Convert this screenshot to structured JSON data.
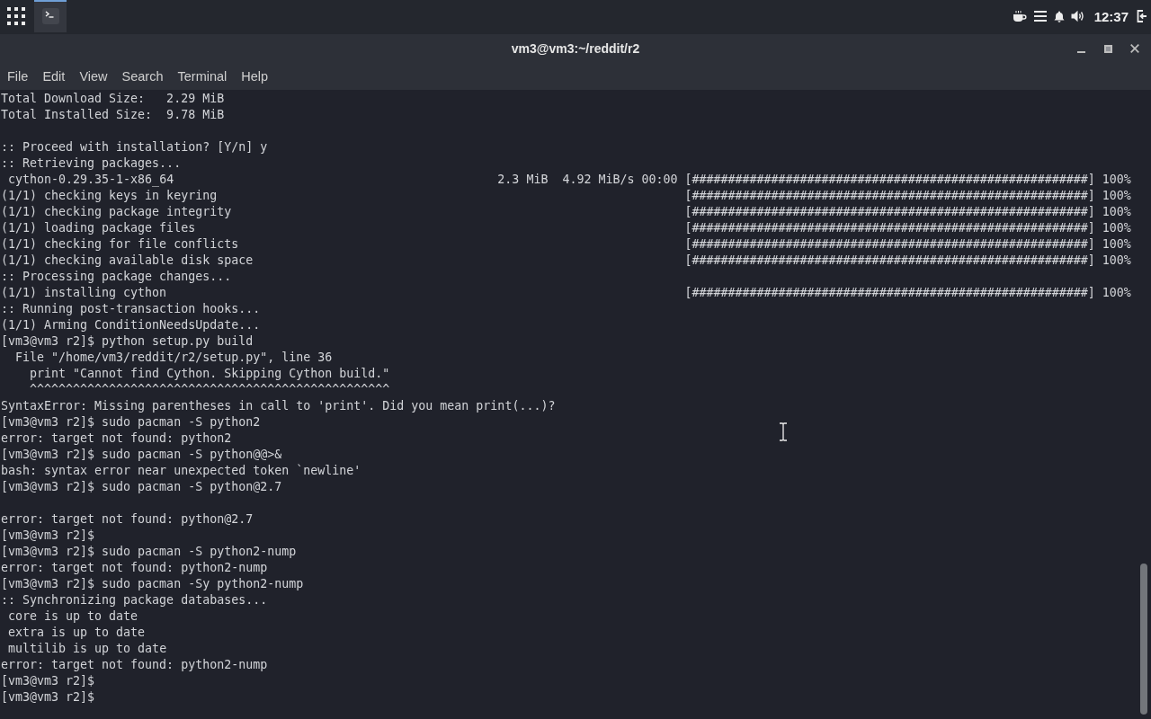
{
  "top_panel": {
    "taskbar": [
      {
        "selected": true
      }
    ],
    "clock": "12:37"
  },
  "window": {
    "title": "vm3@vm3:~/reddit/r2"
  },
  "menu": [
    "File",
    "Edit",
    "View",
    "Search",
    "Terminal",
    "Help"
  ],
  "terminal": {
    "lines": [
      {
        "kind": "text",
        "text": "Total Download Size:   2.29 MiB"
      },
      {
        "kind": "text",
        "text": "Total Installed Size:  9.78 MiB"
      },
      {
        "kind": "blank"
      },
      {
        "kind": "text",
        "text": ":: Proceed with installation? [Y/n] y"
      },
      {
        "kind": "text",
        "text": ":: Retrieving packages..."
      },
      {
        "kind": "progress",
        "text": " cython-0.29.35-1-x86_64",
        "stats": "2.3 MiB  4.92 MiB/s 00:00",
        "progress": "[#######################################################] 100%"
      },
      {
        "kind": "progress",
        "text": "(1/1) checking keys in keyring",
        "progress": "[#######################################################] 100%"
      },
      {
        "kind": "progress",
        "text": "(1/1) checking package integrity",
        "progress": "[#######################################################] 100%"
      },
      {
        "kind": "progress",
        "text": "(1/1) loading package files",
        "progress": "[#######################################################] 100%"
      },
      {
        "kind": "progress",
        "text": "(1/1) checking for file conflicts",
        "progress": "[#######################################################] 100%"
      },
      {
        "kind": "progress",
        "text": "(1/1) checking available disk space",
        "progress": "[#######################################################] 100%"
      },
      {
        "kind": "text",
        "text": ":: Processing package changes..."
      },
      {
        "kind": "progress",
        "text": "(1/1) installing cython",
        "progress": "[#######################################################] 100%"
      },
      {
        "kind": "text",
        "text": ":: Running post-transaction hooks..."
      },
      {
        "kind": "text",
        "text": "(1/1) Arming ConditionNeedsUpdate..."
      },
      {
        "kind": "text",
        "text": "[vm3@vm3 r2]$ python setup.py build"
      },
      {
        "kind": "text",
        "text": "  File \"/home/vm3/reddit/r2/setup.py\", line 36"
      },
      {
        "kind": "text",
        "text": "    print \"Cannot find Cython. Skipping Cython build.\""
      },
      {
        "kind": "text",
        "text": "    ^^^^^^^^^^^^^^^^^^^^^^^^^^^^^^^^^^^^^^^^^^^^^^^^^^"
      },
      {
        "kind": "text",
        "text": "SyntaxError: Missing parentheses in call to 'print'. Did you mean print(...)?"
      },
      {
        "kind": "text",
        "text": "[vm3@vm3 r2]$ sudo pacman -S python2"
      },
      {
        "kind": "text",
        "text": "error: target not found: python2"
      },
      {
        "kind": "text",
        "text": "[vm3@vm3 r2]$ sudo pacman -S python@@>&"
      },
      {
        "kind": "text",
        "text": "bash: syntax error near unexpected token `newline'"
      },
      {
        "kind": "text",
        "text": "[vm3@vm3 r2]$ sudo pacman -S python@2.7"
      },
      {
        "kind": "blank"
      },
      {
        "kind": "text",
        "text": "error: target not found: python@2.7"
      },
      {
        "kind": "text",
        "text": "[vm3@vm3 r2]$"
      },
      {
        "kind": "text",
        "text": "[vm3@vm3 r2]$ sudo pacman -S python2-nump"
      },
      {
        "kind": "text",
        "text": "error: target not found: python2-nump"
      },
      {
        "kind": "text",
        "text": "[vm3@vm3 r2]$ sudo pacman -Sy python2-nump"
      },
      {
        "kind": "text",
        "text": ":: Synchronizing package databases..."
      },
      {
        "kind": "text",
        "text": " core is up to date"
      },
      {
        "kind": "text",
        "text": " extra is up to date"
      },
      {
        "kind": "text",
        "text": " multilib is up to date"
      },
      {
        "kind": "text",
        "text": "error: target not found: python2-nump"
      },
      {
        "kind": "text",
        "text": "[vm3@vm3 r2]$"
      },
      {
        "kind": "text",
        "text": "[vm3@vm3 r2]$"
      }
    ]
  }
}
